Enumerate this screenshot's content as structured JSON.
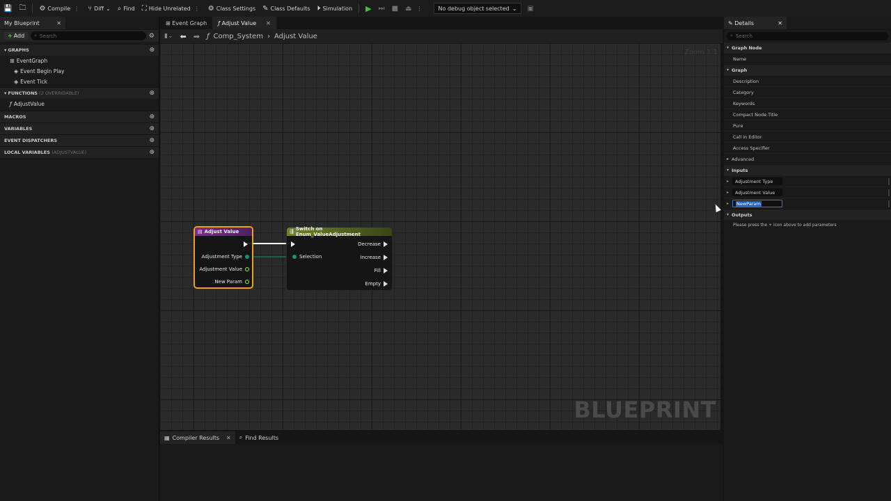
{
  "toolbar": {
    "compile": "Compile",
    "diff": "Diff",
    "find": "Find",
    "hide_unrelated": "Hide Unrelated",
    "class_settings": "Class Settings",
    "class_defaults": "Class Defaults",
    "simulation": "Simulation",
    "debug_object": "No debug object selected"
  },
  "left_panel": {
    "tab_title": "My Blueprint",
    "add_label": "Add",
    "search_placeholder": "Search",
    "graphs_header": "GRAPHS",
    "graph_items": [
      "EventGraph",
      "Event Begin Play",
      "Event Tick"
    ],
    "functions_header": "FUNCTIONS",
    "functions_note": "(2 OVERRIDABLE)",
    "function_items": [
      "AdjustValue"
    ],
    "macros_header": "MACROS",
    "variables_header": "VARIABLES",
    "dispatchers_header": "EVENT DISPATCHERS",
    "local_vars_header": "LOCAL VARIABLES",
    "local_vars_note": "(ADJUSTVALUE)"
  },
  "center": {
    "tabs": [
      "Event Graph",
      "Adjust Value"
    ],
    "breadcrumb": [
      "Comp_System",
      "Adjust Value"
    ],
    "zoom_label": "Zoom 1:1",
    "watermark": "BLUEPRINT",
    "entry_node": {
      "title": "Adjust Value",
      "pins": [
        "Adjustment Type",
        "Adjustment Value",
        "New Param"
      ],
      "header_color": "#7a2d8f"
    },
    "switch_node": {
      "title": "Switch on Enum_ValueAdjustment",
      "input_pin": "Selection",
      "outputs": [
        "Decrease",
        "Increase",
        "Fill",
        "Empty"
      ],
      "header_color": "#6f8426"
    },
    "bottom_tabs": [
      "Compiler Results",
      "Find Results"
    ]
  },
  "details": {
    "tab_title": "Details",
    "search_placeholder": "Search",
    "graph_node_header": "Graph Node",
    "name_label": "Name",
    "graph_header": "Graph",
    "graph_props": [
      "Description",
      "Category",
      "Keywords",
      "Compact Node Title",
      "Pure",
      "Call In Editor",
      "Access Specifier"
    ],
    "advanced_label": "Advanced",
    "inputs_header": "Inputs",
    "inputs": [
      "Adjustment Type",
      "Adjustment Value",
      "NewParam"
    ],
    "outputs_header": "Outputs",
    "outputs_hint": "Please press the + icon above to add parameters"
  },
  "colors": {
    "selection_outline": "#f0a020",
    "exec_wire": "#ffffff",
    "enum_pin": "#1b8f78",
    "float_pin": "#9ff03a",
    "play_green": "#3fc13f"
  }
}
